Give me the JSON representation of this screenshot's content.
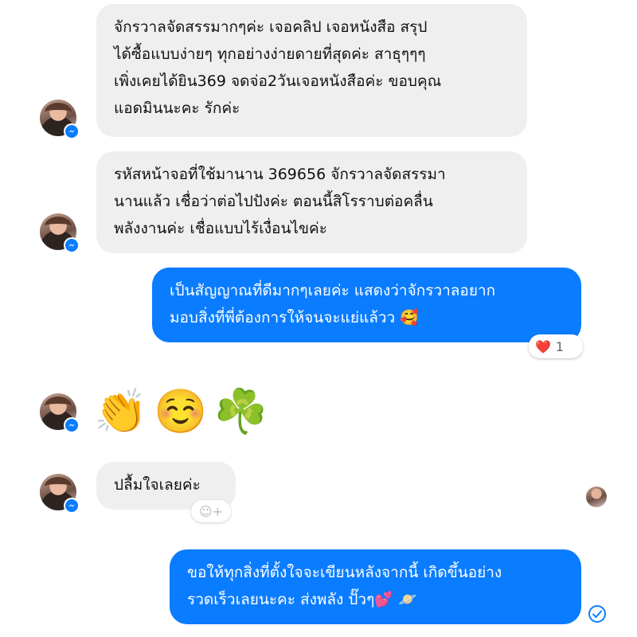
{
  "messages": [
    {
      "id": "m1",
      "direction": "incoming",
      "lines": [
        "จักรวาลจัดสรรมากๆค่ะ เจอคลิป เจอหนังสือ สรุป",
        "ได้ซื้อแบบง่ายๆ ทุกอย่างง่ายดายที่สุดค่ะ สาธุๆๆๆ",
        "เพิ่งเคยได้ยิน369 จดจ่อ2วันเจอหนังสือค่ะ ขอบคุณ",
        "แอดมินนะคะ รักค่ะ"
      ]
    },
    {
      "id": "m2",
      "direction": "incoming",
      "lines": [
        "รหัสหน้าจอที่ใช้มานาน 369656 จักรวาลจัดสรรมา",
        "นานแล้ว เชื่อว่าต่อไปปังค่ะ ตอนนี้สิโรราบต่อคลื่น",
        "พลังงานค่ะ เชื่อแบบไร้เงื่อนไขค่ะ"
      ]
    },
    {
      "id": "m3",
      "direction": "outgoing",
      "lines": [
        "เป็นสัญญาณที่ดีมากๆเลยค่ะ แสดงว่าจักรวาลอยาก",
        "มอบสิ่งที่พี่ต้องการให้จนจะแย่แล้วว 🥰"
      ],
      "reaction": {
        "emoji": "❤️",
        "count": "1"
      }
    },
    {
      "id": "m4",
      "direction": "incoming",
      "emojis": "👏☺️☘️"
    },
    {
      "id": "m5",
      "direction": "incoming",
      "lines": [
        "ปลื้มใจเลยค่ะ"
      ],
      "add_reaction": "☺+"
    },
    {
      "id": "m6",
      "direction": "outgoing",
      "lines": [
        "ขอให้ทุกสิ่งที่ตั้งใจจะเขียนหลังจากนี้ เกิดขึ้นอย่าง",
        "รวดเร็วเลยนะคะ ส่งพลัง ปั๊วๆ💕 🪐"
      ]
    }
  ],
  "colors": {
    "incoming_bubble": "#efefef",
    "outgoing_bubble": "#0a7cff",
    "messenger_badge": "#0a7cff"
  },
  "icons": {
    "avatar_badge": "messenger-icon",
    "status": "sent-check-icon"
  }
}
